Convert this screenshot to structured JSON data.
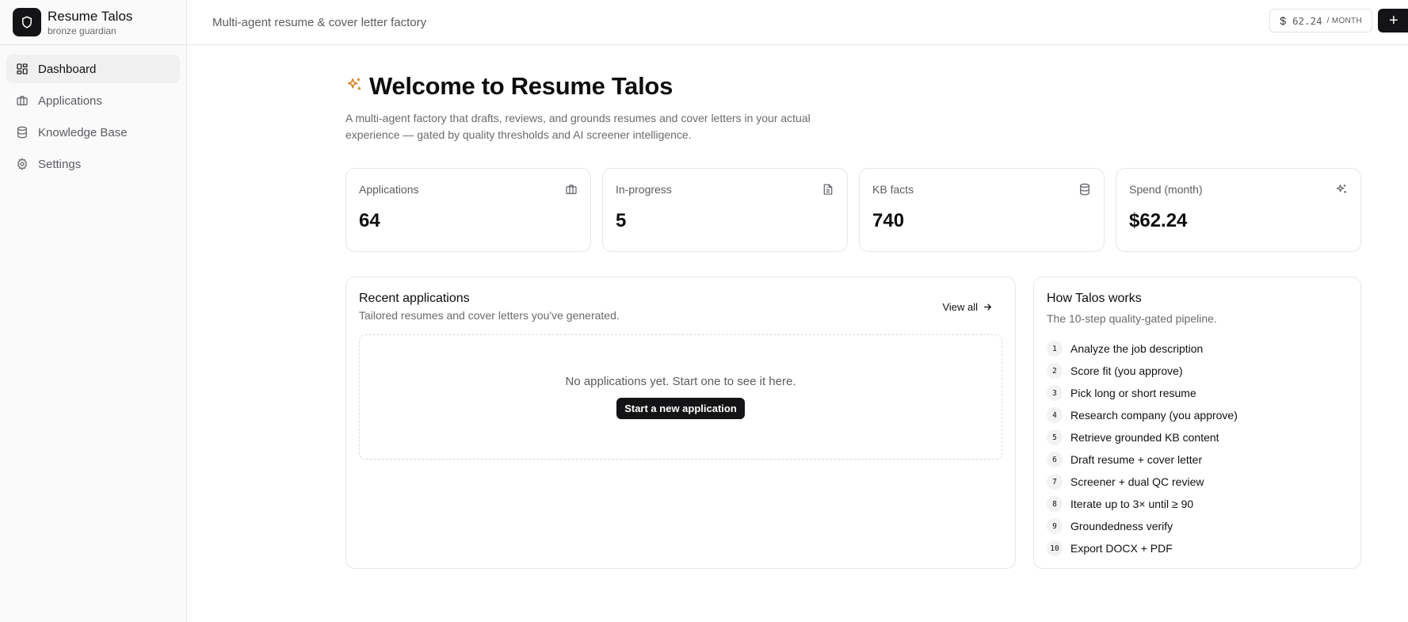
{
  "app": {
    "name": "Resume Talos",
    "subtitle": "bronze guardian"
  },
  "sidebar": {
    "items": [
      {
        "label": "Dashboard",
        "icon": "dashboard-icon",
        "active": true
      },
      {
        "label": "Applications",
        "icon": "briefcase-icon",
        "active": false
      },
      {
        "label": "Knowledge Base",
        "icon": "database-icon",
        "active": false
      },
      {
        "label": "Settings",
        "icon": "gear-icon",
        "active": false
      }
    ]
  },
  "topbar": {
    "title": "Multi-agent resume & cover letter factory",
    "spend_symbol": "$",
    "spend_value": "62.24",
    "spend_unit": "/ MONTH",
    "add_label": "+"
  },
  "welcome": {
    "title": "Welcome to Resume Talos",
    "description": "A multi-agent factory that drafts, reviews, and grounds resumes and cover letters in your actual experience — gated by quality thresholds and AI screener intelligence."
  },
  "stats": [
    {
      "label": "Applications",
      "value": "64",
      "icon": "briefcase-icon"
    },
    {
      "label": "In-progress",
      "value": "5",
      "icon": "document-icon"
    },
    {
      "label": "KB facts",
      "value": "740",
      "icon": "database-icon"
    },
    {
      "label": "Spend (month)",
      "value": "$62.24",
      "icon": "sparkles-icon"
    }
  ],
  "recent": {
    "title": "Recent applications",
    "subtitle": "Tailored resumes and cover letters you've generated.",
    "view_all": "View all",
    "empty_text": "No applications yet. Start one to see it here.",
    "start_button": "Start a new application"
  },
  "how": {
    "title": "How Talos works",
    "subtitle": "The 10-step quality-gated pipeline.",
    "steps": [
      {
        "num": "1",
        "text": "Analyze the job description"
      },
      {
        "num": "2",
        "text": "Score fit (you approve)"
      },
      {
        "num": "3",
        "text": "Pick long or short resume"
      },
      {
        "num": "4",
        "text": "Research company (you approve)"
      },
      {
        "num": "5",
        "text": "Retrieve grounded KB content"
      },
      {
        "num": "6",
        "text": "Draft resume + cover letter"
      },
      {
        "num": "7",
        "text": "Screener + dual QC review"
      },
      {
        "num": "8",
        "text": "Iterate up to 3× until ≥ 90"
      },
      {
        "num": "9",
        "text": "Groundedness verify"
      },
      {
        "num": "10",
        "text": "Export DOCX + PDF"
      }
    ]
  },
  "colors": {
    "accent_sparkle": "#d9862c",
    "dark": "#141416",
    "muted_text": "#6b6b70",
    "border": "#e6e6e8"
  }
}
